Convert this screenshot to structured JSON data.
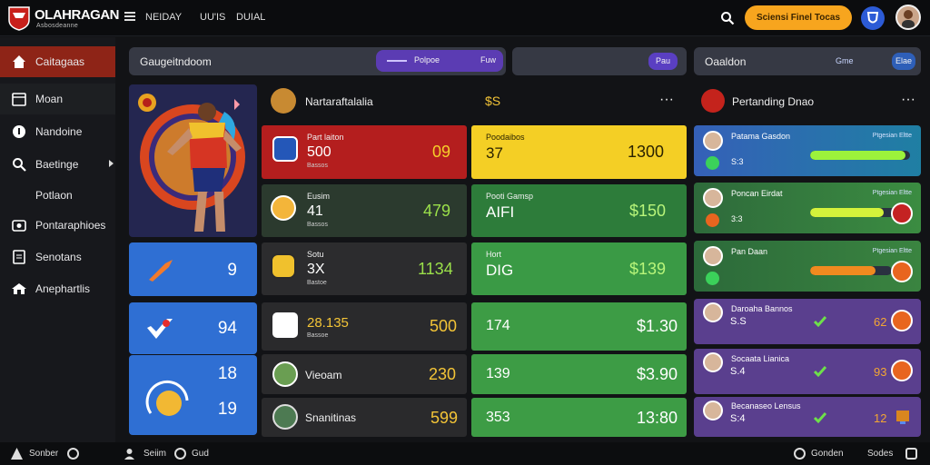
{
  "header": {
    "brand": "OLAHRAGAN",
    "brand_sub": "Asbosdeanne",
    "nav": [
      "NEIDAY",
      "UU'IS",
      "DUIAL"
    ],
    "promo_label": "Sciensi Finel Tocas",
    "icons": [
      "menu-icon",
      "search-icon",
      "shield-badge-icon",
      "user-avatar"
    ]
  },
  "sidebar": {
    "items": [
      {
        "label": "Caitagaas",
        "icon": "home-icon",
        "active": true
      },
      {
        "label": "Moan",
        "icon": "calendar-icon"
      },
      {
        "label": "Nandoine",
        "icon": "info-icon"
      },
      {
        "label": "Baetinge",
        "icon": "search-icon",
        "has_arrow": true
      },
      {
        "label": "Potlaon",
        "icon": ""
      },
      {
        "label": "Pontaraphioes",
        "icon": "camera-icon"
      },
      {
        "label": "Senotans",
        "icon": "list-icon"
      },
      {
        "label": "Anephartlis",
        "icon": "house-icon"
      }
    ]
  },
  "toolbar": {
    "search_label": "Gaugeitndoom",
    "pill_label": "Polpoe",
    "pill_badge": "Fuw",
    "mid_pill": "Pau",
    "right_label": "Oaaldon",
    "right_chip1": "Gme",
    "right_chip2": "Elae"
  },
  "hero_stats": [
    {
      "value": "9",
      "color": "#2f6fd3"
    },
    {
      "value": "94",
      "color": "#2f6fd3"
    },
    {
      "value": "18",
      "color": "#2f6fd3"
    },
    {
      "value": "19",
      "color": "#2f6fd3"
    }
  ],
  "col1": {
    "title": "Nartaraftalalia",
    "mid_header": "$S",
    "rows": [
      {
        "title": "Part laiton",
        "big": "500",
        "sub": "Bassos",
        "value": "09"
      },
      {
        "title": "Eusim",
        "big": "41",
        "sub": "Bassos",
        "value": "479"
      },
      {
        "title": "Sotu",
        "big": "3X",
        "sub": "Bastoe",
        "value": "1134"
      },
      {
        "title": "",
        "big": "28.135",
        "sub": "Bassoe",
        "value": "500"
      },
      {
        "title": "",
        "big": "Vieoam",
        "sub": "",
        "value": "230"
      },
      {
        "title": "",
        "big": "Snanitinas",
        "sub": "",
        "value": "599"
      }
    ]
  },
  "col2": {
    "rows": [
      {
        "title": "Poodaibos",
        "big": "37",
        "value": "1300"
      },
      {
        "title": "Pooti Gamsp",
        "big": "AIFI",
        "value": "$150"
      },
      {
        "title": "Hort",
        "big": "DIG",
        "value": "$139"
      },
      {
        "title": "",
        "big": "174",
        "value": "$1.30"
      },
      {
        "title": "",
        "big": "139",
        "value": "$3.90"
      },
      {
        "title": "",
        "big": "353",
        "value": "13:80"
      }
    ]
  },
  "right_panel": {
    "title": "Pertanding Dnao",
    "rows": [
      {
        "name": "Patama Gasdon",
        "link": "Ptgesian Eltte",
        "sub": "S:3",
        "progress": 0.95,
        "value": ""
      },
      {
        "name": "Poncan Eirdat",
        "link": "Ptgesian Eltte",
        "sub": "3:3",
        "progress": 0.85,
        "value": ""
      },
      {
        "name": "Pan Daan",
        "link": "Ptgesian Eltte",
        "sub": "",
        "progress": 0.8,
        "value": ""
      },
      {
        "name": "Daroaha Bannos",
        "link": "",
        "sub": "S.S",
        "progress": null,
        "value": "62"
      },
      {
        "name": "Socaata Lianica",
        "link": "",
        "sub": "S.4",
        "progress": null,
        "value": "93"
      },
      {
        "name": "Becanaseo Lensus",
        "link": "",
        "sub": "S:4",
        "progress": null,
        "value": "12"
      }
    ]
  },
  "footer": {
    "left": "Sonber",
    "mid1": "Seiim",
    "mid2": "Gud",
    "right1": "Gonden",
    "right2": "Sodes"
  }
}
